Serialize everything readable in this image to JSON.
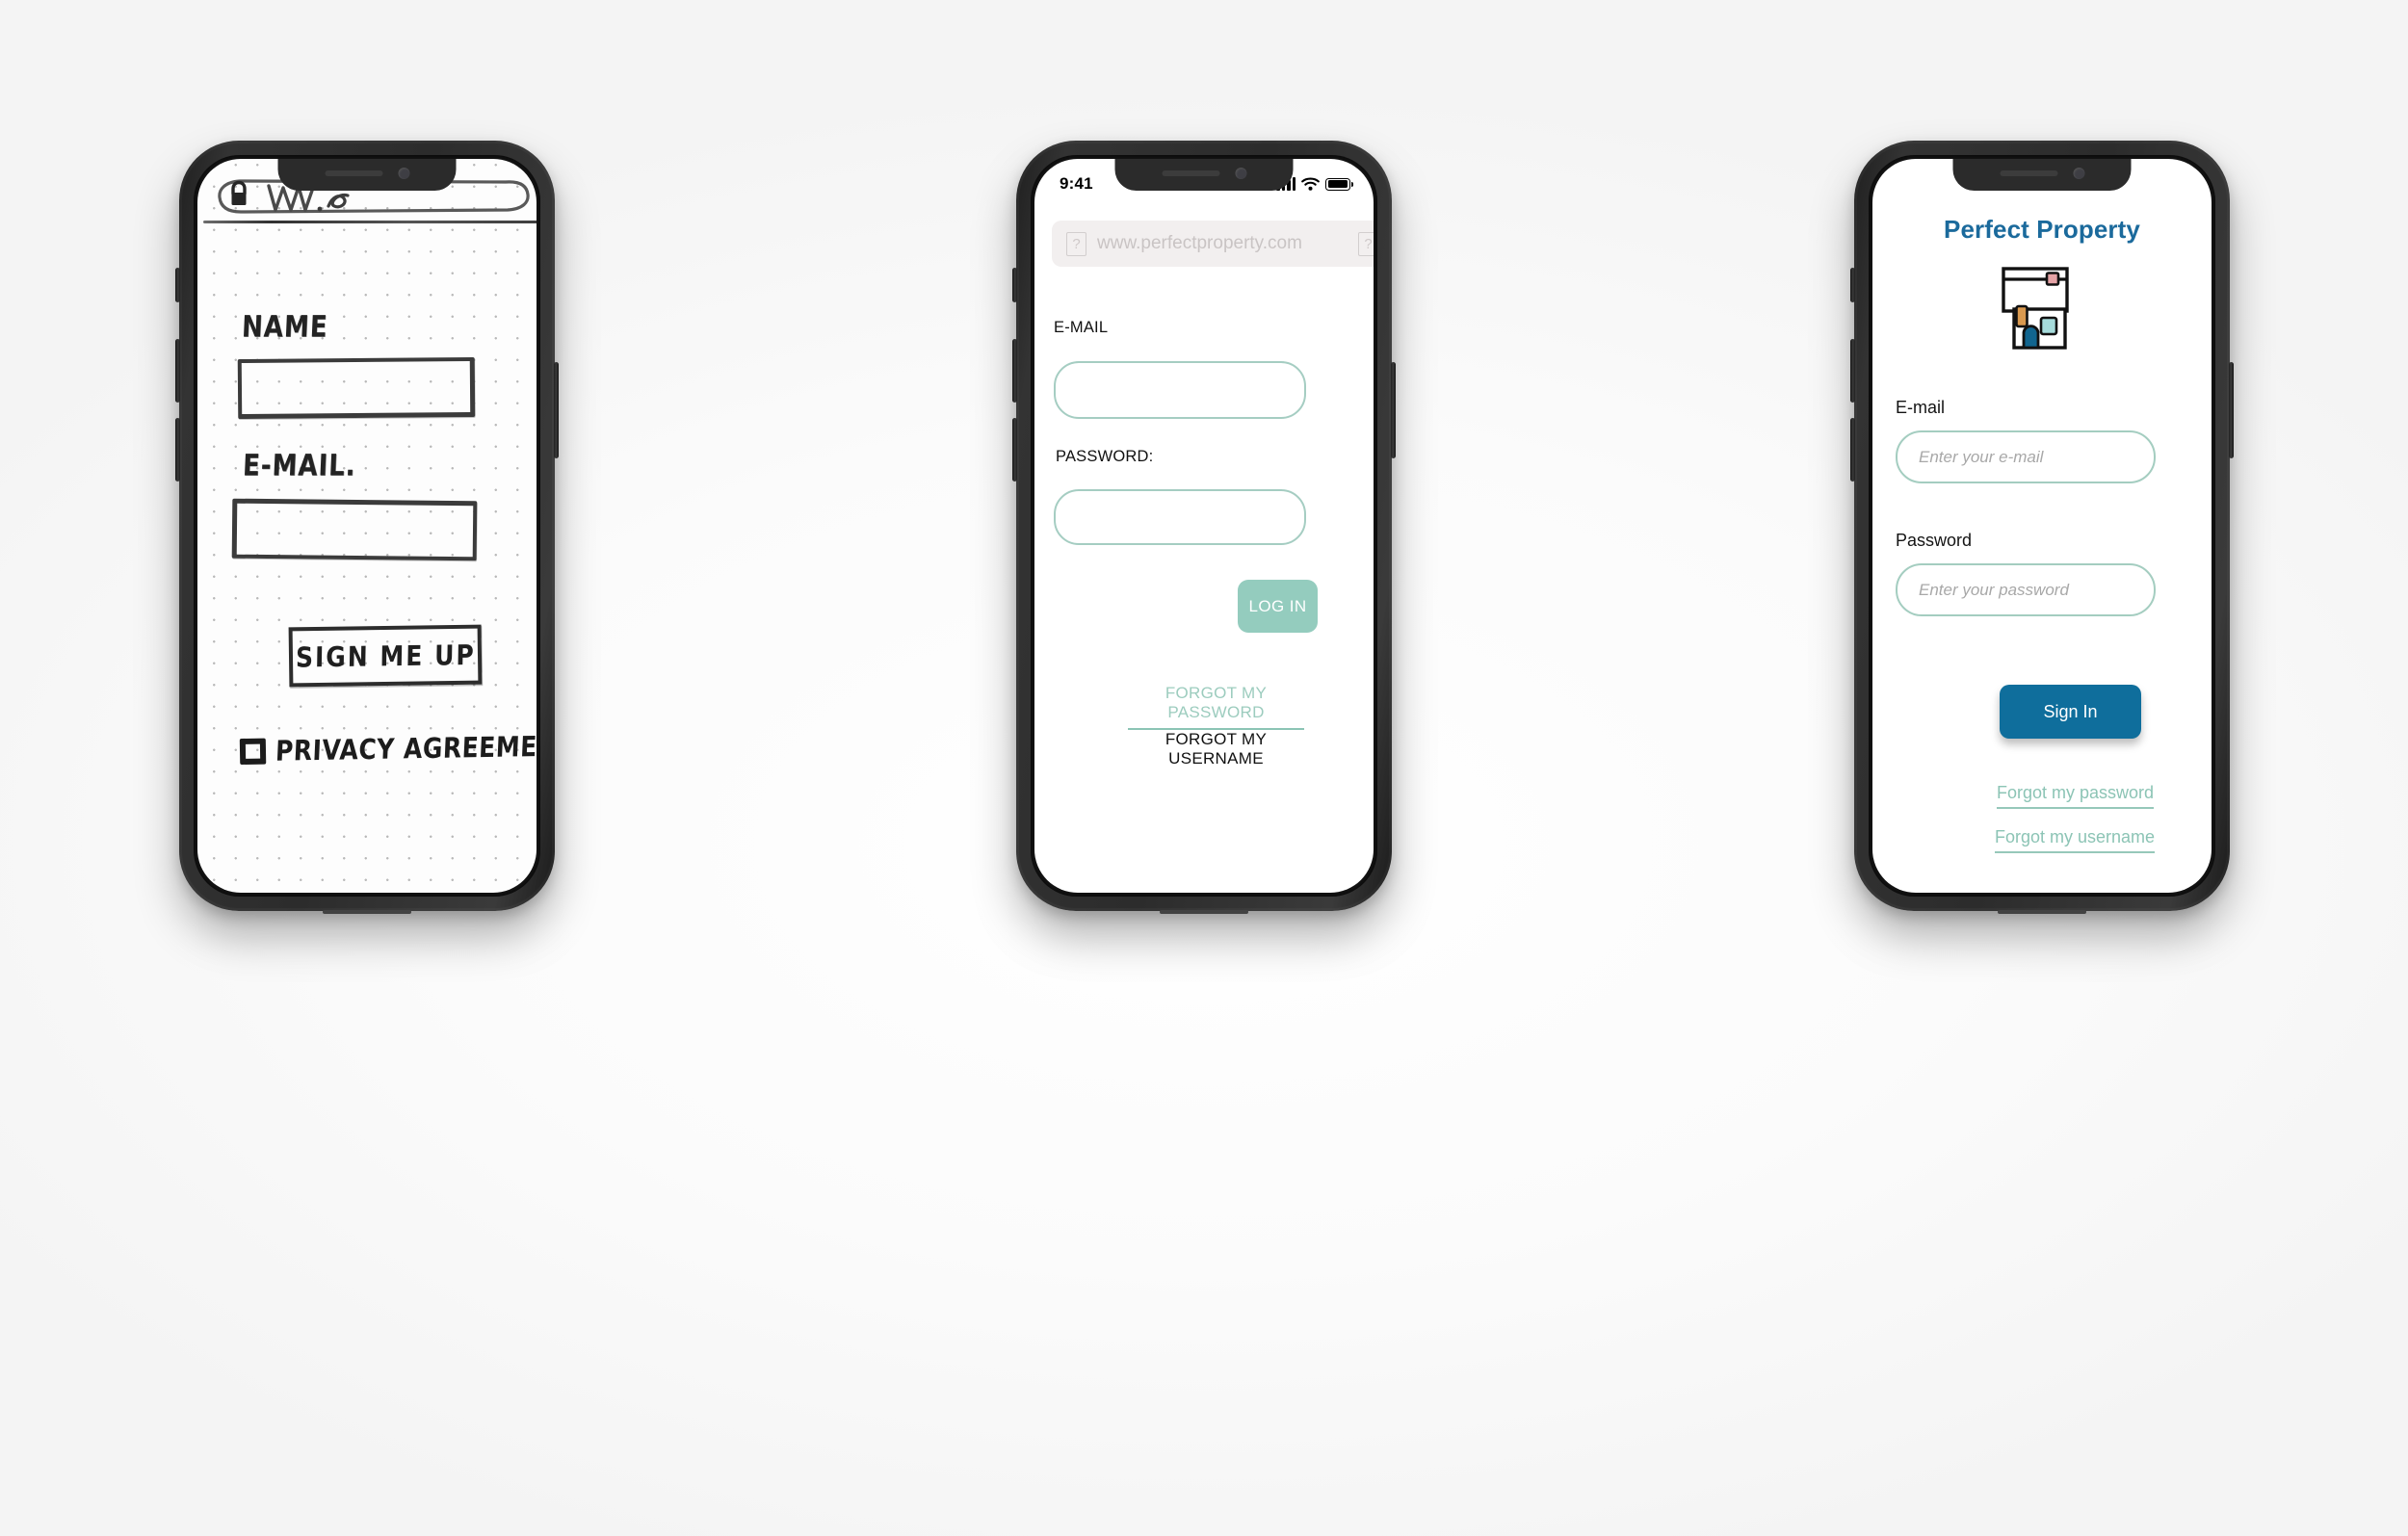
{
  "colors": {
    "brand_blue": "#1b6a9c",
    "signin_blue": "#0f6e9c",
    "teal_accent": "#94ccbe",
    "teal_border": "#a4cdc0",
    "teal_link": "#8cc4b5",
    "sketch_ink": "#2d2d2d",
    "urlbar_grey": "#f2efef",
    "placeholder_grey": "#a8a8a8",
    "logo_door_blue": "#11658f",
    "logo_window_teal": "#a6dcdc",
    "logo_orange": "#d9994f",
    "logo_pink": "#e5a3a6"
  },
  "phone_sketch": {
    "name": "hand-drawn-wireframe",
    "url_bar": {
      "lock_icon": "padlock-icon",
      "text": "www."
    },
    "fields": [
      {
        "label": "NAME",
        "input_name": "name-input"
      },
      {
        "label": "E-MAIL.",
        "input_name": "email-input"
      }
    ],
    "signup_button": "SIGN ME UP",
    "checkbox": {
      "label": "PRIVACY AGREEMENT",
      "checked": false
    }
  },
  "phone_mock": {
    "name": "greybox-mockup",
    "status_bar": {
      "time": "9:41",
      "icons": [
        "cellular-signal-icon",
        "wifi-icon",
        "battery-icon"
      ]
    },
    "url_bar": {
      "left_icon": "?",
      "url": "www.perfectproperty.com",
      "right_icon": "?"
    },
    "fields": [
      {
        "label": "E-MAIL",
        "input_name": "email-input",
        "value": ""
      },
      {
        "label": "PASSWORD:",
        "input_name": "password-input",
        "value": ""
      }
    ],
    "login_button": "LOG IN",
    "links": [
      {
        "label": "FORGOT MY PASSWORD",
        "style": "teal-underlined"
      },
      {
        "label": "FORGOT MY USERNAME",
        "style": "black-plain"
      }
    ]
  },
  "phone_final": {
    "name": "final-ui",
    "title": "Perfect Property",
    "logo": "house-logo-icon",
    "fields": [
      {
        "label": "E-mail",
        "input_name": "email-input",
        "placeholder": "Enter your e-mail",
        "value": ""
      },
      {
        "label": "Password",
        "input_name": "password-input",
        "placeholder": "Enter your password",
        "value": ""
      }
    ],
    "signin_button": "Sign In",
    "links": [
      {
        "label": "Forgot my password"
      },
      {
        "label": "Forgot my username"
      }
    ]
  }
}
